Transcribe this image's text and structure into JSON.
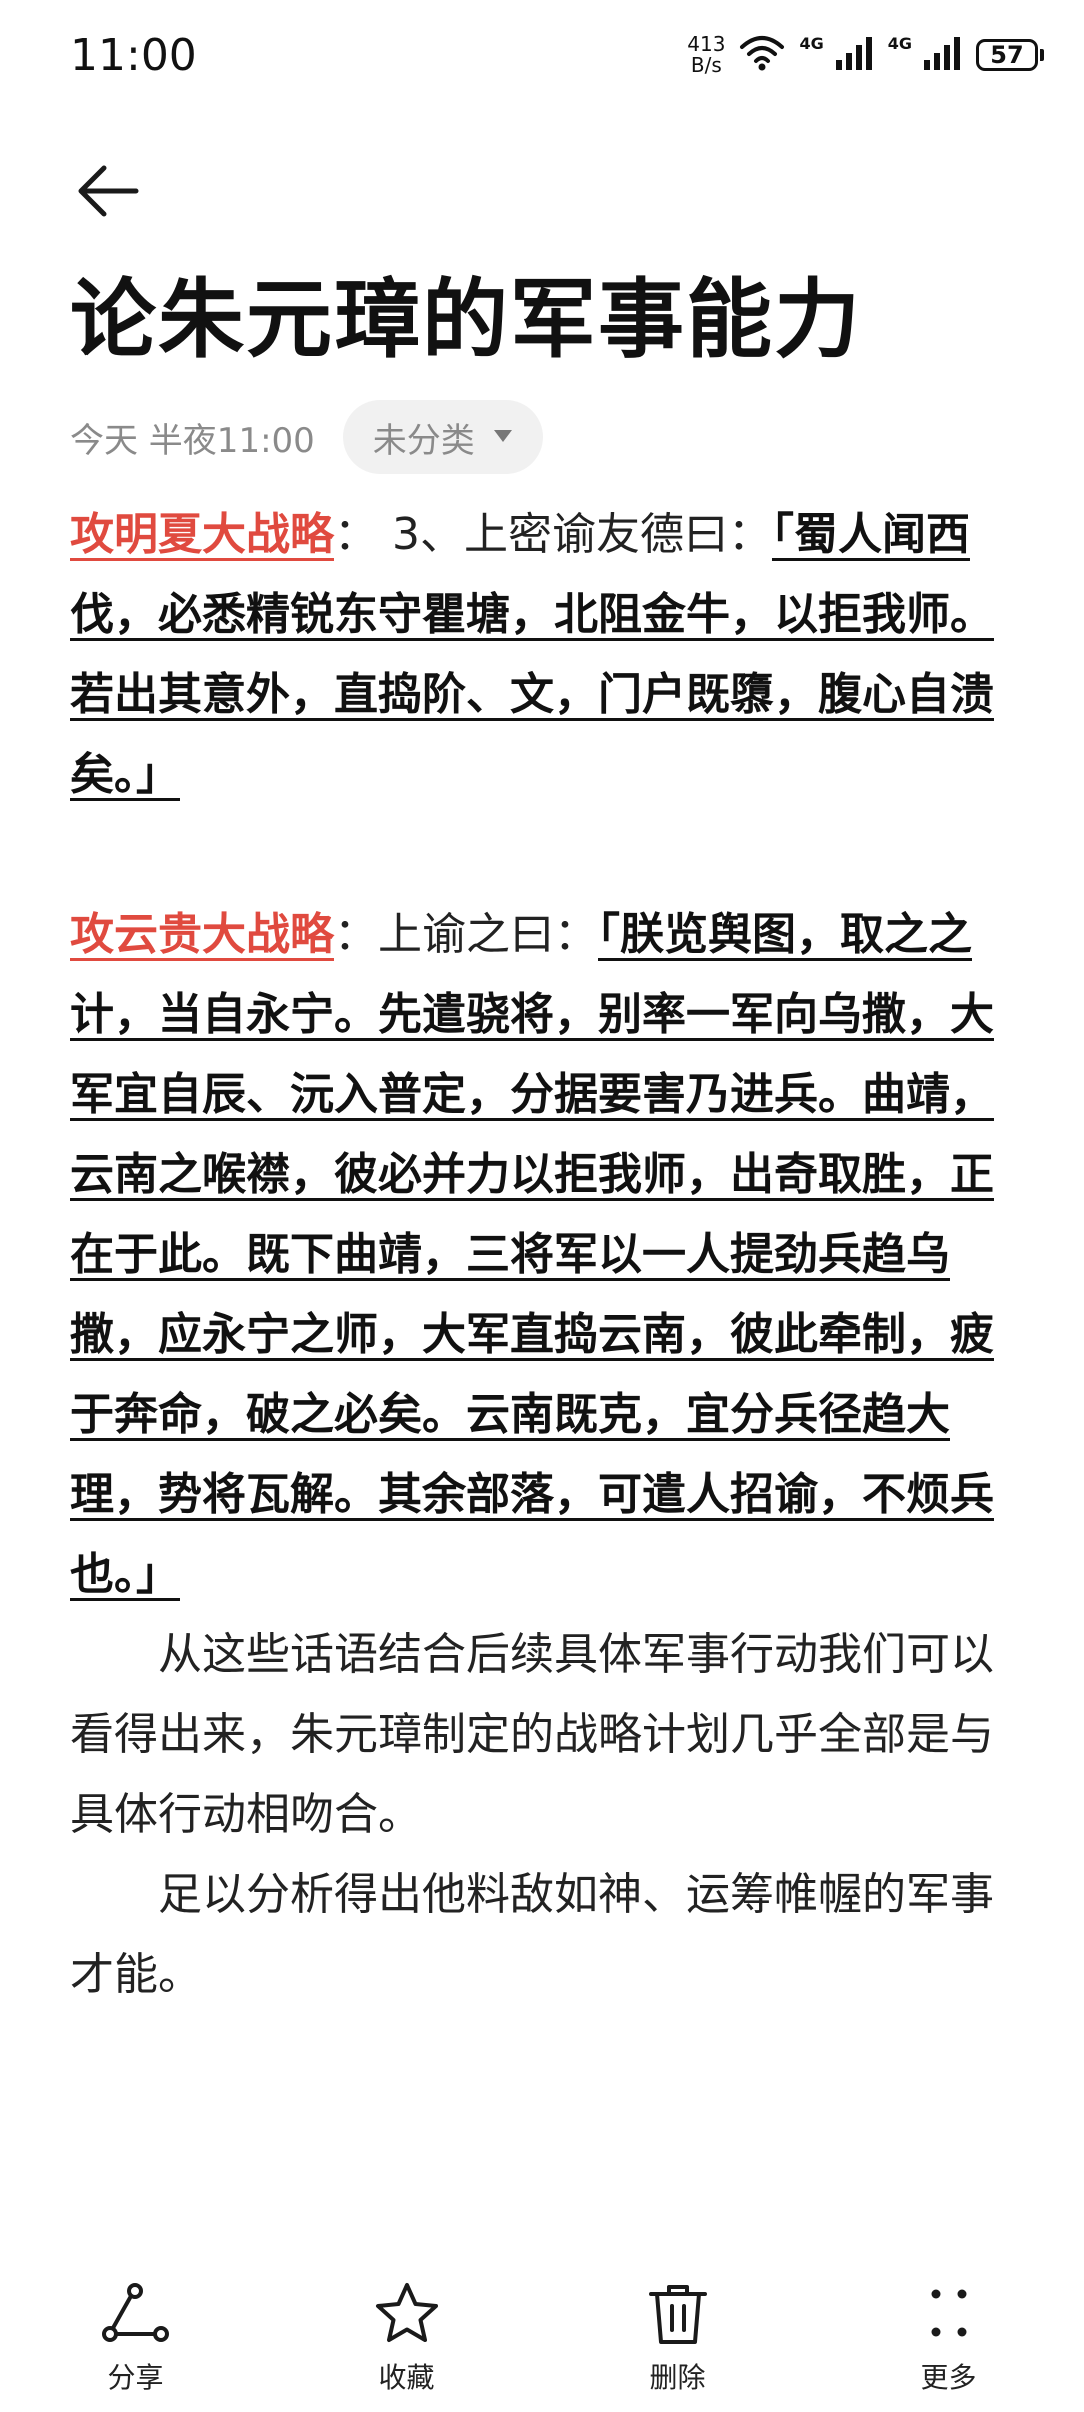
{
  "status_bar": {
    "time": "11:00",
    "speed_value": "413",
    "speed_unit": "B/s",
    "network1": "4G",
    "network2": "4G",
    "battery": "57"
  },
  "header": {
    "title": "论朱元璋的军事能力",
    "timestamp": "今天 半夜11:00",
    "category": "未分类"
  },
  "content": {
    "p1_label": "攻明夏大战略",
    "p1_text": "：  3、上密谕友德曰：",
    "p1_quote": "「蜀人闻西伐，必悉精锐东守瞿塘，北阻金牛，以拒我师。若出其意外，直捣阶、文，门户既隳，腹心自溃矣。」",
    "p2_label": "攻云贵大战略",
    "p2_text": "：上谕之曰：",
    "p2_quote": "「朕览舆图，取之之计，当自永宁。先遣骁将，别率一军向乌撒，大军宜自辰、沅入普定，分据要害乃进兵。曲靖，云南之喉襟，彼必并力以拒我师，出奇取胜，正在于此。既下曲靖，三将军以一人提劲兵趋乌撒，应永宁之师，大军直捣云南，彼此牵制，疲于奔命，破之必矣。云南既克，宜分兵径趋大理，势将瓦解。其余部落，可遣人招谕，不烦兵也。」",
    "p3": "从这些话语结合后续具体军事行动我们可以看得出来，朱元璋制定的战略计划几乎全部是与具体行动相吻合。",
    "p4": "足以分析得出他料敌如神、运筹帷幄的军事才能。"
  },
  "toolbar": {
    "share": "分享",
    "favorite": "收藏",
    "delete": "删除",
    "more": "更多"
  },
  "colors": {
    "accent_red": "#e04a3f",
    "meta_gray": "#8a8a8a",
    "chip_bg": "#f1f1f1"
  },
  "icons": [
    "back-arrow-icon",
    "dropdown-caret-icon",
    "share-icon",
    "star-icon",
    "trash-icon",
    "more-dots-icon",
    "wifi-icon",
    "signal-icon",
    "battery-icon"
  ]
}
